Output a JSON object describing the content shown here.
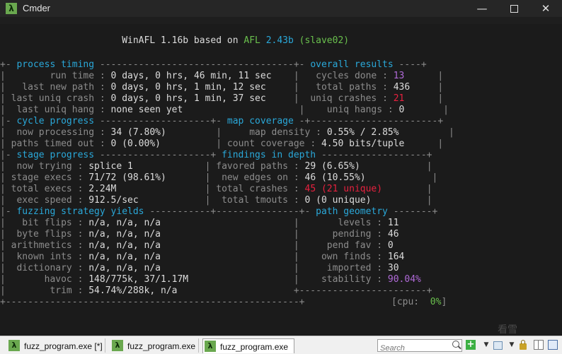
{
  "window": {
    "title": "Cmder",
    "app_icon_glyph": "λ",
    "min_glyph": "—",
    "close_glyph": "✕"
  },
  "terminal": {
    "header": {
      "prefix": "WinAFL 1.16b based on ",
      "afl": "AFL",
      "version": "2.43b",
      "slave": "(slave02)"
    },
    "process_timing": {
      "title": "process timing",
      "rows": [
        {
          "label": "       run time",
          "value": "0 days, 0 hrs, 46 min, 11 sec"
        },
        {
          "label": "  last new path",
          "value": "0 days, 0 hrs, 1 min, 12 sec"
        },
        {
          "label": "last uniq crash",
          "value": "0 days, 0 hrs, 1 min, 37 sec"
        },
        {
          "label": " last uniq hang",
          "value": "none seen yet"
        }
      ]
    },
    "overall_results": {
      "title": "overall results",
      "rows": [
        {
          "label": " cycles done",
          "value": "13"
        },
        {
          "label": " total paths",
          "value": "436"
        },
        {
          "label": "uniq crashes",
          "value": "21"
        },
        {
          "label": "  uniq hangs",
          "value": "0"
        }
      ]
    },
    "cycle_progress": {
      "title": "cycle progress",
      "rows": [
        {
          "label": " now processing",
          "value": "34 (7.80%)"
        },
        {
          "label": "paths timed out",
          "value": "0 (0.00%)"
        }
      ]
    },
    "map_coverage": {
      "title": "map coverage",
      "rows": [
        {
          "label": "   map density",
          "value": "0.55% / 2.85%"
        },
        {
          "label": "count coverage",
          "value": "4.50 bits/tuple"
        }
      ]
    },
    "stage_progress": {
      "title": "stage progress",
      "rows": [
        {
          "label": " now trying",
          "value": "splice 1"
        },
        {
          "label": "stage execs",
          "value": "71/72 (98.61%)"
        },
        {
          "label": "total execs",
          "value": "2.24M"
        },
        {
          "label": " exec speed",
          "value": "912.5/sec"
        }
      ]
    },
    "findings_in_depth": {
      "title": "findings in depth",
      "rows": [
        {
          "label": "favored paths",
          "value": "29 (6.65%)"
        },
        {
          "label": " new edges on",
          "value": "46 (10.55%)"
        },
        {
          "label": "total crashes",
          "value": "45 (21 unique)"
        },
        {
          "label": " total tmouts",
          "value": "0 (0 unique)"
        }
      ]
    },
    "fuzzing_strategy_yields": {
      "title": "fuzzing strategy yields",
      "rows": [
        {
          "label": "  bit flips",
          "value": "n/a, n/a, n/a"
        },
        {
          "label": " byte flips",
          "value": "n/a, n/a, n/a"
        },
        {
          "label": "arithmetics",
          "value": "n/a, n/a, n/a"
        },
        {
          "label": " known ints",
          "value": "n/a, n/a, n/a"
        },
        {
          "label": " dictionary",
          "value": "n/a, n/a, n/a"
        },
        {
          "label": "      havoc",
          "value": "148/775k, 37/1.17M"
        },
        {
          "label": "       trim",
          "value": "54.74%/288k, n/a"
        }
      ]
    },
    "path_geometry": {
      "title": "path geometry",
      "rows": [
        {
          "label": "   levels",
          "value": "11"
        },
        {
          "label": "  pending",
          "value": "46"
        },
        {
          "label": " pend fav",
          "value": "0"
        },
        {
          "label": "own finds",
          "value": "164"
        },
        {
          "label": " imported",
          "value": "30"
        },
        {
          "label": "stability",
          "value": "90.04%"
        }
      ]
    },
    "cpu": {
      "label": "[cpu:  ",
      "value": "0%",
      "close": "]"
    }
  },
  "statusbar": {
    "tabs": [
      {
        "label": "fuzz_program.exe [*]"
      },
      {
        "label": "fuzz_program.exe"
      },
      {
        "label": "fuzz_program.exe"
      }
    ],
    "search_placeholder": "Search",
    "add_glyph": "+",
    "dropdown_glyph": "▼"
  },
  "watermark": "看雪",
  "colors": {
    "section_title": "#2aa8d9",
    "value": "#dcdcdc",
    "label": "#8c8c8c",
    "crash": "#e8213f",
    "purple": "#b06ad8",
    "green": "#6ac04d"
  }
}
